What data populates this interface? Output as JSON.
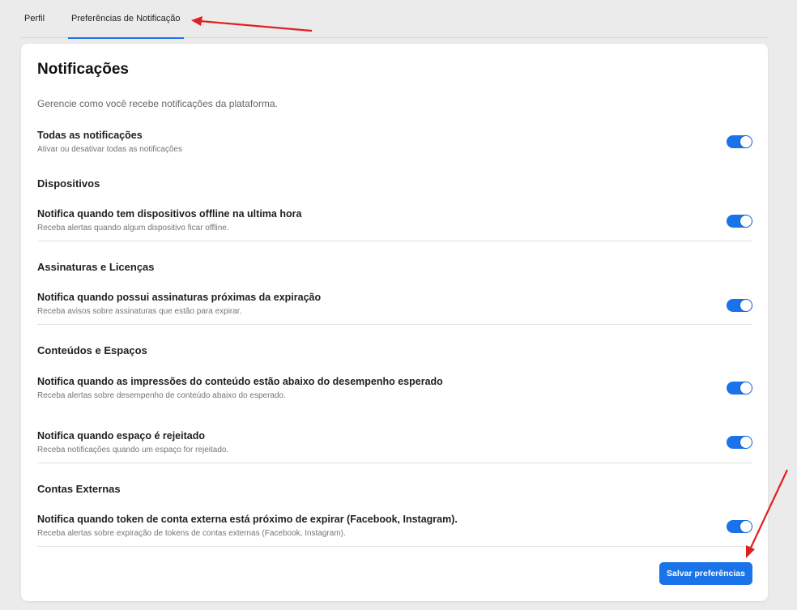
{
  "tabs": [
    {
      "label": "Perfil",
      "active": false
    },
    {
      "label": "Preferências de Notificação",
      "active": true
    }
  ],
  "card": {
    "title": "Notificações",
    "subtitle": "Gerencie como você recebe notificações da plataforma."
  },
  "all_notifications": {
    "label": "Todas as notificações",
    "description": "Ativar ou desativar todas as notificações",
    "enabled": true
  },
  "sections": [
    {
      "title": "Dispositivos",
      "items": [
        {
          "label": "Notifica quando tem dispositivos offline na ultima hora",
          "description": "Receba alertas quando algum dispositivo ficar offline.",
          "enabled": true
        }
      ]
    },
    {
      "title": "Assinaturas e Licenças",
      "items": [
        {
          "label": "Notifica quando possui assinaturas próximas da expiração",
          "description": "Receba avisos sobre assinaturas que estão para expirar.",
          "enabled": true
        }
      ]
    },
    {
      "title": "Conteúdos e Espaços",
      "items": [
        {
          "label": "Notifica quando as impressões do conteúdo estão abaixo do desempenho esperado",
          "description": "Receba alertas sobre desempenho de conteúdo abaixo do esperado.",
          "enabled": true
        },
        {
          "label": "Notifica quando espaço é rejeitado",
          "description": "Receba notificações quando um espaço for rejeitado.",
          "enabled": true
        }
      ]
    },
    {
      "title": "Contas Externas",
      "items": [
        {
          "label": "Notifica quando token de conta externa está próximo de expirar (Facebook, Instagram).",
          "description": "Receba alertas sobre expiração de tokens de contas externas (Facebook, Instagram).",
          "enabled": true
        }
      ]
    }
  ],
  "save_button": {
    "label": "Salvar preferências"
  },
  "colors": {
    "accent": "#1a73e8",
    "annotation_arrow": "#e02020",
    "background": "#ebebeb"
  }
}
